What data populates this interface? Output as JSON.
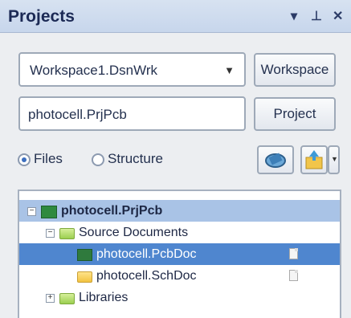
{
  "panel": {
    "title": "Projects",
    "controls": {
      "dropdown": "▾",
      "pin": "⊥",
      "close": "✕"
    }
  },
  "workspace": {
    "selected": "Workspace1.DsnWrk",
    "button": "Workspace"
  },
  "project": {
    "value": "photocell.PrjPcb",
    "button": "Project"
  },
  "view_mode": {
    "files": "Files",
    "structure": "Structure",
    "selected": "Files"
  },
  "tree": {
    "root": "photocell.PrjPcb",
    "source_documents": "Source Documents",
    "pcb_doc": "photocell.PcbDoc",
    "sch_doc": "photocell.SchDoc",
    "libraries": "Libraries"
  },
  "colors": {
    "title_bar": "#c7d6ec",
    "selection": "#4f86cf",
    "project_highlight": "#a9c3e6"
  }
}
